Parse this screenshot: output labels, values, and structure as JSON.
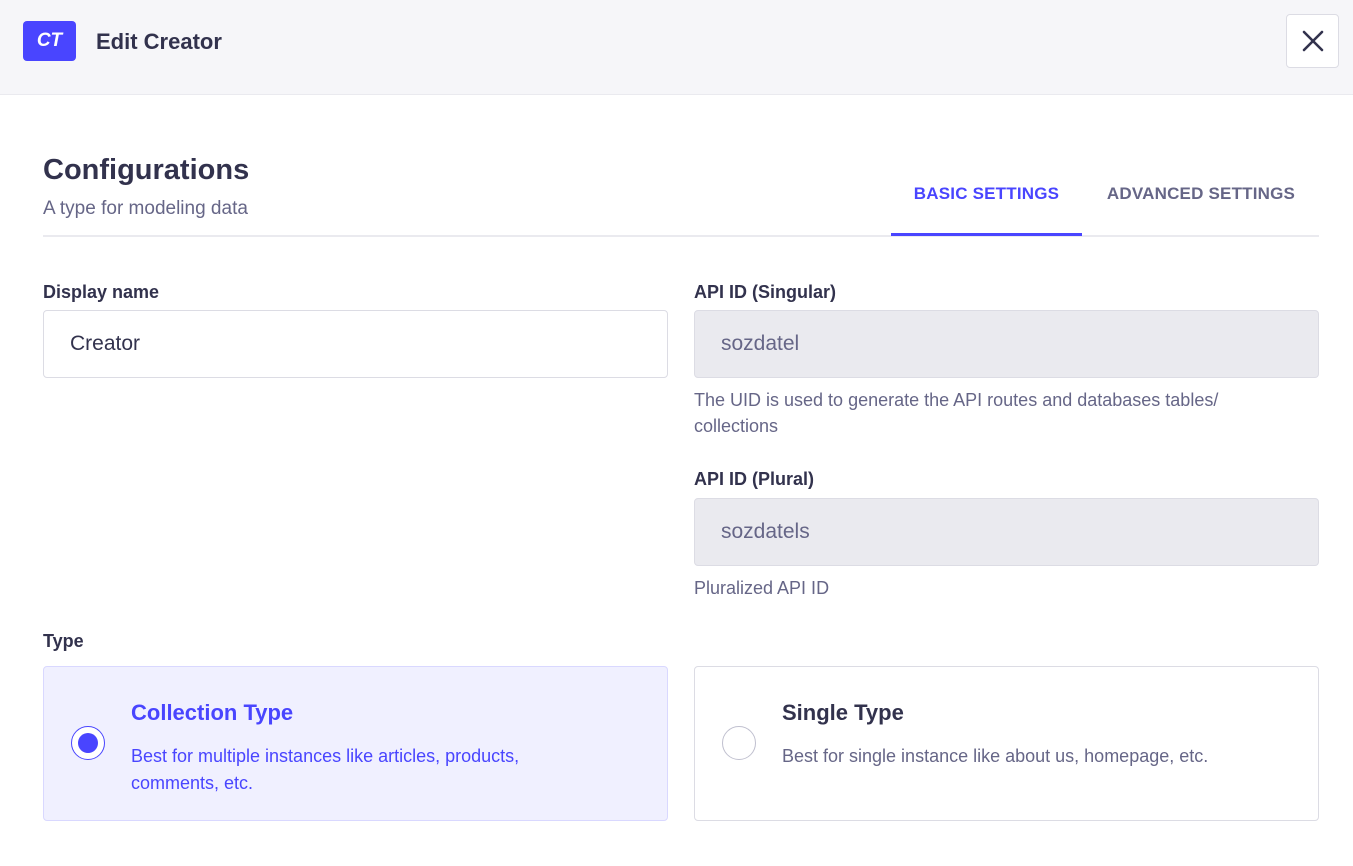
{
  "header": {
    "badge": "CT",
    "title": "Edit Creator",
    "close_icon": "close-icon"
  },
  "configurations": {
    "title": "Configurations",
    "subtitle": "A type for modeling data"
  },
  "tabs": [
    {
      "label": "BASIC SETTINGS",
      "active": true
    },
    {
      "label": "ADVANCED SETTINGS",
      "active": false
    }
  ],
  "form": {
    "display_name": {
      "label": "Display name",
      "value": "Creator"
    },
    "api_id_singular": {
      "label": "API ID (Singular)",
      "value": "sozdatel",
      "hint": "The UID is used to generate the API routes and databases tables/ collections"
    },
    "api_id_plural": {
      "label": "API ID (Plural)",
      "value": "sozdatels",
      "hint": "Pluralized API ID"
    },
    "type": {
      "label": "Type",
      "options": [
        {
          "title": "Collection Type",
          "description": "Best for multiple instances like articles, products, comments, etc.",
          "selected": true
        },
        {
          "title": "Single Type",
          "description": "Best for single instance like about us, homepage, etc.",
          "selected": false
        }
      ]
    }
  },
  "colors": {
    "primary": "#4945ff",
    "text": "#32324d",
    "muted": "#666687",
    "selected_card_bg": "#f0f0ff",
    "disabled_input_bg": "#eaeaef"
  }
}
